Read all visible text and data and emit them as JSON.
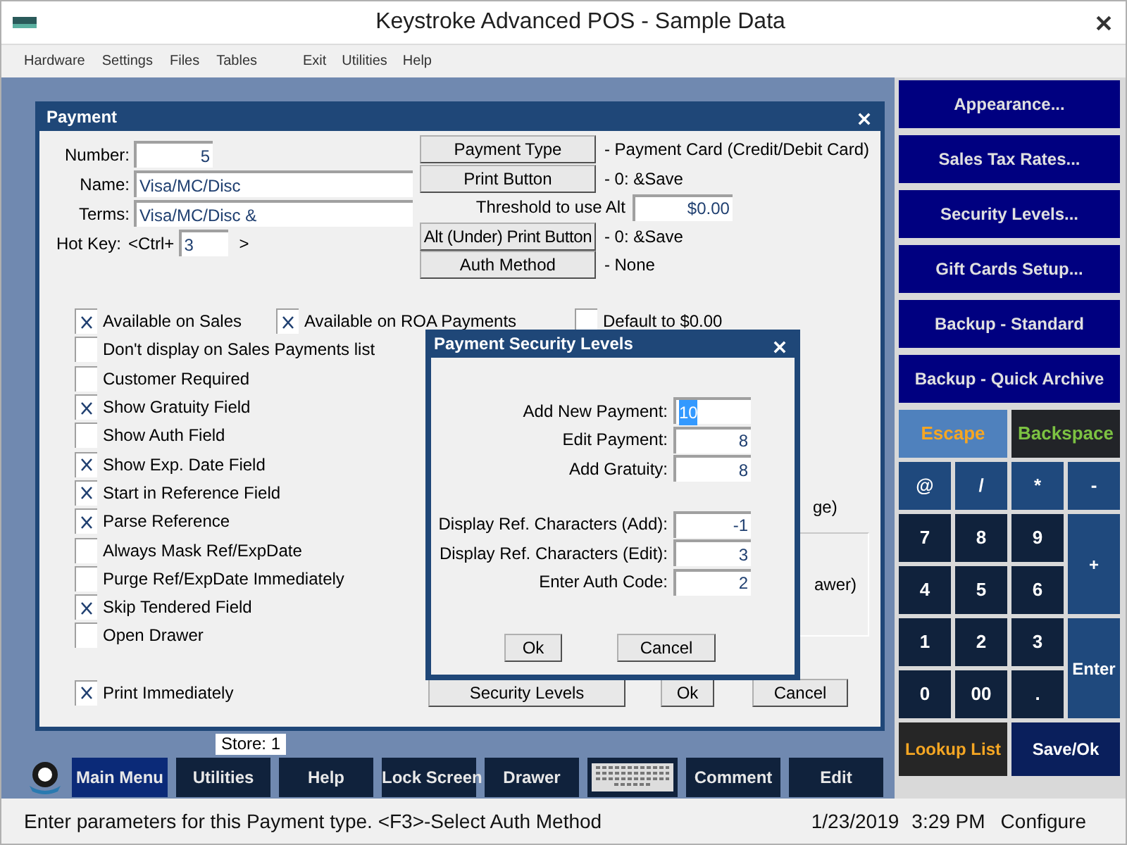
{
  "window": {
    "title": "Keystroke Advanced POS - Sample Data"
  },
  "menu_left": [
    "Hardware",
    "Settings",
    "Files",
    "Tables"
  ],
  "menu_right": [
    "Exit",
    "Utilities",
    "Help"
  ],
  "payment": {
    "title": "Payment",
    "number": {
      "label": "Number:",
      "value": "5"
    },
    "name": {
      "label": "Name:",
      "value": "Visa/MC/Disc"
    },
    "terms": {
      "label": "Terms:",
      "value": "Visa/MC/Disc &"
    },
    "hotkey": {
      "label": "Hot Key:",
      "prefix": "<Ctrl+",
      "value": "3",
      "suffix": ">"
    },
    "type_button": {
      "label": "Payment Type",
      "info": "- Payment Card (Credit/Debit Card)"
    },
    "print_button": {
      "label": "Print Button",
      "info": "- 0: &Save"
    },
    "threshold": {
      "label": "Threshold to use Alt",
      "value": "$0.00"
    },
    "alt_print_button": {
      "label": "Alt (Under) Print Button",
      "info": "- 0: &Save"
    },
    "auth_button": {
      "label": "Auth Method",
      "info": "-  None"
    },
    "top_checkboxes": [
      {
        "label": "Available on Sales",
        "checked": true
      },
      {
        "label": "Available on ROA Payments",
        "checked": true
      },
      {
        "label": "Default to $0.00",
        "checked": false
      }
    ],
    "checkboxes": [
      {
        "label": "Don't display on Sales Payments list",
        "checked": false
      },
      {
        "label": "Customer Required",
        "checked": false
      },
      {
        "label": "Show Gratuity Field",
        "checked": true
      },
      {
        "label": "Show Auth Field",
        "checked": false
      },
      {
        "label": "Show Exp. Date Field",
        "checked": true
      },
      {
        "label": "Start in Reference Field",
        "checked": true
      },
      {
        "label": "Parse Reference",
        "checked": true
      },
      {
        "label": "Always Mask Ref/ExpDate",
        "checked": false
      },
      {
        "label": "Purge Ref/ExpDate Immediately",
        "checked": false
      },
      {
        "label": "Skip Tendered Field",
        "checked": true
      },
      {
        "label": "Open Drawer",
        "checked": false
      }
    ],
    "hidden_fragment_1": "ge)",
    "hidden_fragment_2": "awer)",
    "print_immediately": {
      "label": "Print Immediately",
      "checked": true
    },
    "buttons": [
      "Security Levels",
      "Ok",
      "Cancel"
    ]
  },
  "security": {
    "title": "Payment Security Levels",
    "group_1": [
      {
        "label": "Add New Payment:",
        "value": "10",
        "selected": true
      },
      {
        "label": "Edit Payment:",
        "value": "8",
        "selected": false
      },
      {
        "label": "Add Gratuity:",
        "value": "8",
        "selected": false
      }
    ],
    "group_2": [
      {
        "label": "Display Ref. Characters (Add):",
        "value": "-1",
        "selected": false
      },
      {
        "label": "Display Ref. Characters (Edit):",
        "value": "3",
        "selected": false
      },
      {
        "label": "Enter Auth Code:",
        "value": "2",
        "selected": false
      }
    ],
    "buttons": [
      "Ok",
      "Cancel"
    ]
  },
  "side_buttons": [
    "Appearance...",
    "Sales Tax Rates...",
    "Security Levels...",
    "Gift Cards Setup...",
    "Backup - Standard",
    "Backup - Quick Archive"
  ],
  "keypad": [
    {
      "label": "Escape",
      "kind": "escape"
    },
    {
      "label": "Backspace",
      "kind": "backspace"
    },
    {
      "label": "@",
      "kind": "op"
    },
    {
      "label": "/",
      "kind": "op"
    },
    {
      "label": "*",
      "kind": "op"
    },
    {
      "label": "-",
      "kind": "op"
    },
    {
      "label": "7",
      "kind": "digit"
    },
    {
      "label": "8",
      "kind": "digit"
    },
    {
      "label": "9",
      "kind": "digit"
    },
    {
      "label": "+",
      "kind": "tall"
    },
    {
      "label": "4",
      "kind": "digit"
    },
    {
      "label": "5",
      "kind": "digit"
    },
    {
      "label": "6",
      "kind": "digit"
    },
    {
      "label": "1",
      "kind": "digit"
    },
    {
      "label": "2",
      "kind": "digit"
    },
    {
      "label": "3",
      "kind": "digit"
    },
    {
      "label": "Enter",
      "kind": "tall"
    },
    {
      "label": "0",
      "kind": "digit"
    },
    {
      "label": "00",
      "kind": "digit"
    },
    {
      "label": ".",
      "kind": "digit"
    },
    {
      "label": "Lookup List",
      "kind": "lookup"
    },
    {
      "label": "Save/Ok",
      "kind": "save"
    }
  ],
  "store": "Store: 1",
  "bottom_buttons": [
    {
      "label": "Main Menu",
      "kind": "menu"
    },
    {
      "label": "Utilities",
      "kind": "normal"
    },
    {
      "label": "Help",
      "kind": "normal"
    },
    {
      "label": "Lock Screen",
      "kind": "normal"
    },
    {
      "label": "Drawer",
      "kind": "normal"
    },
    {
      "kind": "keyboard"
    },
    {
      "label": "Comment",
      "kind": "normal"
    },
    {
      "label": "Edit",
      "kind": "normal"
    }
  ],
  "status_bar": {
    "message": "Enter parameters for this Payment type. <F3>-Select Auth Method",
    "date": "1/23/2019",
    "time": "3:29 PM",
    "mode": "Configure"
  }
}
